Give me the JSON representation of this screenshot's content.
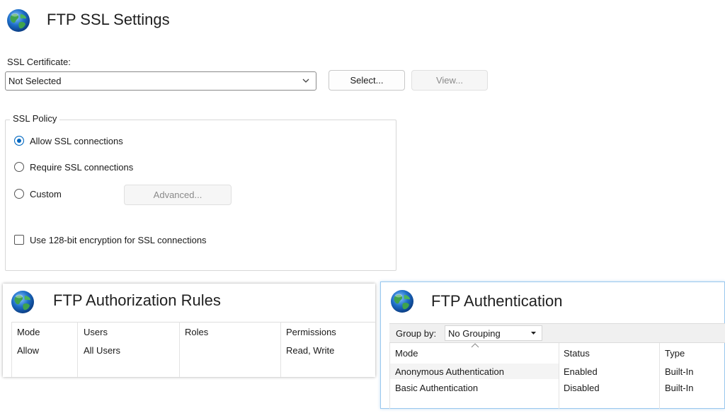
{
  "ssl_settings": {
    "title": "FTP SSL Settings",
    "certificate_label": "SSL Certificate:",
    "certificate_value": "Not Selected",
    "select_button": "Select...",
    "view_button": "View...",
    "policy": {
      "legend": "SSL Policy",
      "options": [
        {
          "label": "Allow SSL connections",
          "selected": true
        },
        {
          "label": "Require SSL connections",
          "selected": false
        },
        {
          "label": "Custom",
          "selected": false
        }
      ],
      "advanced_button": "Advanced...",
      "encryption_checkbox": {
        "label": "Use 128-bit encryption for SSL connections",
        "checked": false
      }
    }
  },
  "authorization_rules": {
    "title": "FTP Authorization Rules",
    "columns": [
      "Mode",
      "Users",
      "Roles",
      "Permissions"
    ],
    "rows": [
      {
        "mode": "Allow",
        "users": "All Users",
        "roles": "",
        "permissions": "Read, Write"
      }
    ]
  },
  "authentication": {
    "title": "FTP Authentication",
    "group_by_label": "Group by:",
    "group_by_value": "No Grouping",
    "columns": [
      "Mode",
      "Status",
      "Type"
    ],
    "rows": [
      {
        "mode": "Anonymous Authentication",
        "status": "Enabled",
        "type": "Built-In"
      },
      {
        "mode": "Basic Authentication",
        "status": "Disabled",
        "type": "Built-In"
      }
    ]
  },
  "colors": {
    "accent": "#0067c0",
    "focus_border": "#99c7ee",
    "globe_ocean": "#1e6fc9",
    "globe_land": "#3fa34d"
  },
  "icons": [
    "globe-icon",
    "chevron-down-icon",
    "sort-up-icon",
    "dropdown-arrow-icon"
  ]
}
